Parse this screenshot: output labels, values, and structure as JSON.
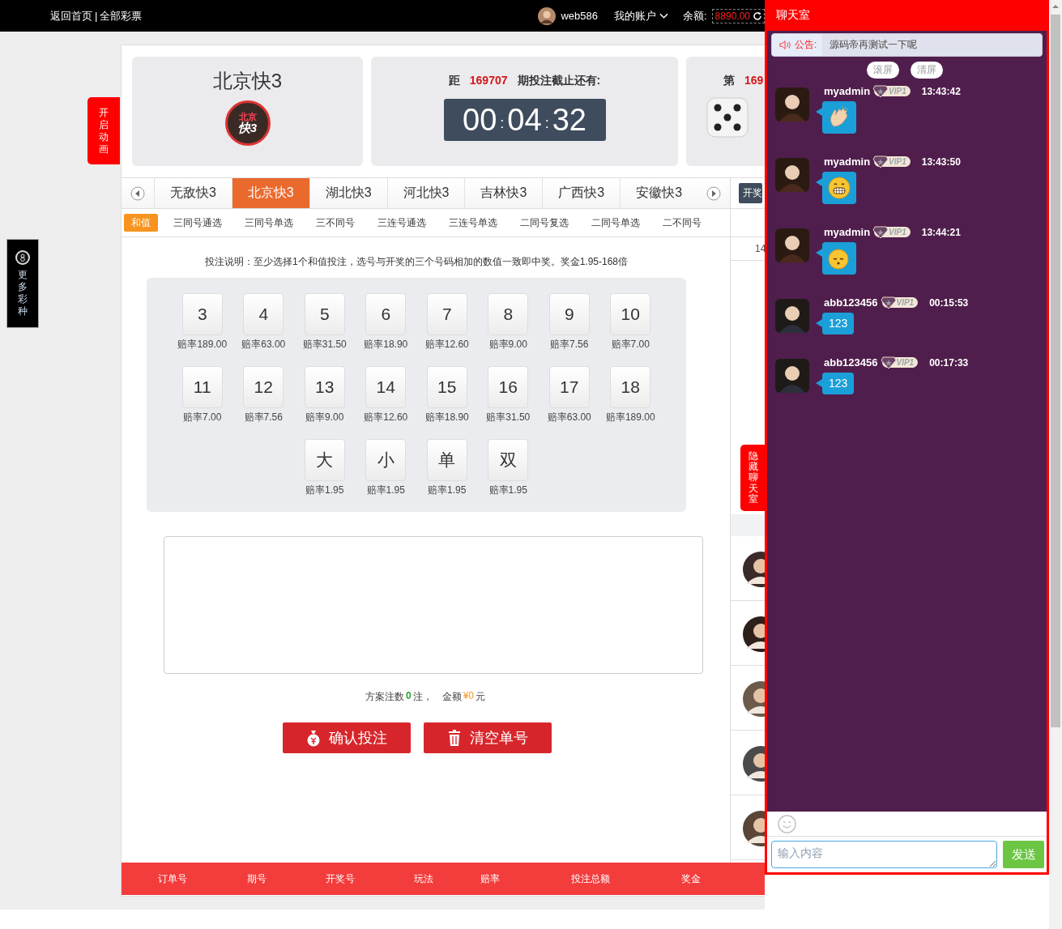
{
  "topbar": {
    "home": "返回首页",
    "separator": "|",
    "all": "全部彩票",
    "user": "web586",
    "account": "我的账户",
    "balance_label": "余额:",
    "balance": "8890.00"
  },
  "animation_toggle": "开启动画",
  "more_games": "更多彩种",
  "lottery": {
    "name": "北京快3",
    "logo_city": "北京",
    "logo_game": "快3"
  },
  "countdown": {
    "prefix": "距",
    "issue": "169707",
    "suffix": "期投注截止还有:",
    "hours": "00",
    "minutes": "04",
    "seconds": "32",
    "separator": ":"
  },
  "last_draw": {
    "prefix": "第",
    "issue": "169"
  },
  "game_tabs": [
    {
      "label": "无敌快3",
      "selected": false
    },
    {
      "label": "北京快3",
      "selected": true
    },
    {
      "label": "湖北快3",
      "selected": false
    },
    {
      "label": "河北快3",
      "selected": false
    },
    {
      "label": "吉林快3",
      "selected": false
    },
    {
      "label": "广西快3",
      "selected": false
    },
    {
      "label": "安徽快3",
      "selected": false
    }
  ],
  "play_tabs": [
    {
      "label": "和值",
      "selected": true
    },
    {
      "label": "三同号通选",
      "selected": false
    },
    {
      "label": "三同号单选",
      "selected": false
    },
    {
      "label": "三不同号",
      "selected": false
    },
    {
      "label": "三连号通选",
      "selected": false
    },
    {
      "label": "三连号单选",
      "selected": false
    },
    {
      "label": "二同号复选",
      "selected": false
    },
    {
      "label": "二同号单选",
      "selected": false
    },
    {
      "label": "二不同号",
      "selected": false
    }
  ],
  "rules": "投注说明：至少选择1个和值投注，选号与开奖的三个号码相加的数值一致即中奖。奖金1.95-168倍",
  "numbers": [
    {
      "label": "3",
      "odds": "赔率189.00"
    },
    {
      "label": "4",
      "odds": "赔率63.00"
    },
    {
      "label": "5",
      "odds": "赔率31.50"
    },
    {
      "label": "6",
      "odds": "赔率18.90"
    },
    {
      "label": "7",
      "odds": "赔率12.60"
    },
    {
      "label": "8",
      "odds": "赔率9.00"
    },
    {
      "label": "9",
      "odds": "赔率7.56"
    },
    {
      "label": "10",
      "odds": "赔率7.00"
    },
    {
      "label": "11",
      "odds": "赔率7.00"
    },
    {
      "label": "12",
      "odds": "赔率7.56"
    },
    {
      "label": "13",
      "odds": "赔率9.00"
    },
    {
      "label": "14",
      "odds": "赔率12.60"
    },
    {
      "label": "15",
      "odds": "赔率18.90"
    },
    {
      "label": "16",
      "odds": "赔率31.50"
    },
    {
      "label": "17",
      "odds": "赔率63.00"
    },
    {
      "label": "18",
      "odds": "赔率189.00"
    },
    {
      "label": "大",
      "odds": "赔率1.95"
    },
    {
      "label": "小",
      "odds": "赔率1.95"
    },
    {
      "label": "单",
      "odds": "赔率1.95"
    },
    {
      "label": "双",
      "odds": "赔率1.95"
    }
  ],
  "summary": {
    "count_label": "方案注数",
    "count": "0",
    "count_unit": "注，",
    "amount_label": "金额",
    "amount": "¥0",
    "amount_unit": "元"
  },
  "actions": [
    {
      "label": "确认投注",
      "kind": "confirm"
    },
    {
      "label": "清空单号",
      "kind": "clear"
    }
  ],
  "order_columns": [
    "订单号",
    "期号",
    "开奖号",
    "玩法",
    "赔率",
    "投注总额",
    "奖金"
  ],
  "side": {
    "button": "开奖",
    "text": "14"
  },
  "hide_chat": "隐藏聊天室",
  "chat": {
    "title": "聊天室",
    "notice_label": "公告:",
    "notice": "源码帝再测试一下呢",
    "tools": [
      "滚屏",
      "清屏"
    ],
    "messages": [
      {
        "user": "myadmin",
        "vip": "VIP1",
        "time": "13:43:42",
        "kind": "clap"
      },
      {
        "user": "myadmin",
        "vip": "VIP1",
        "time": "13:43:50",
        "kind": "grin"
      },
      {
        "user": "myadmin",
        "vip": "VIP1",
        "time": "13:44:21",
        "kind": "sleep"
      },
      {
        "user": "abb123456",
        "vip": "VIP1",
        "time": "00:15:53",
        "kind": "text",
        "text": "123"
      },
      {
        "user": "abb123456",
        "vip": "VIP1",
        "time": "00:17:33",
        "kind": "text",
        "text": "123"
      }
    ],
    "placeholder": "输入内容",
    "send": "发送"
  }
}
